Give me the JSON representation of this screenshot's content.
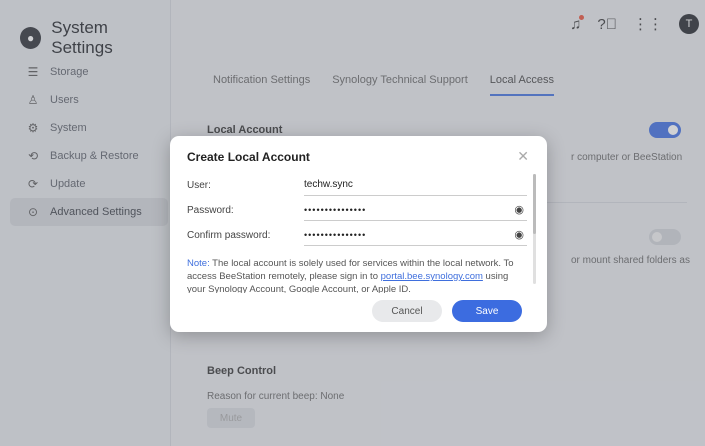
{
  "app": {
    "title": "System Settings"
  },
  "sidebar": {
    "items": [
      {
        "label": "Storage",
        "icon": "storage-icon",
        "glyph": "☰"
      },
      {
        "label": "Users",
        "icon": "user-icon",
        "glyph": "♙"
      },
      {
        "label": "System",
        "icon": "wrench-icon",
        "glyph": "⚙"
      },
      {
        "label": "Backup & Restore",
        "icon": "backup-icon",
        "glyph": "⟲"
      },
      {
        "label": "Update",
        "icon": "update-icon",
        "glyph": "⟳"
      },
      {
        "label": "Advanced Settings",
        "icon": "advanced-icon",
        "glyph": "⊙"
      }
    ],
    "active_index": 5
  },
  "topbar": {
    "avatar_letter": "T"
  },
  "tabs": [
    {
      "label": "Notification Settings"
    },
    {
      "label": "Synology Technical Support"
    },
    {
      "label": "Local Access"
    }
  ],
  "content": {
    "local_account_title": "Local Account",
    "local_account_desc_tail": "r computer or BeeStation",
    "second_desc_tail": "or mount shared folders as",
    "beep_title": "Beep Control",
    "beep_reason": "Reason for current beep: None",
    "mute_label": "Mute"
  },
  "modal": {
    "title": "Create Local Account",
    "fields": {
      "user_label": "User:",
      "user_value": "techw.sync",
      "password_label": "Password:",
      "password_value": "•••••••••••••••",
      "confirm_label": "Confirm password:",
      "confirm_value": "•••••••••••••••"
    },
    "note_label": "Note:",
    "note_text_1": " The local account is solely used for services within the local network. To access BeeStation remotely, please sign in to ",
    "note_link": "portal.bee.synology.com",
    "note_text_2": " using your Synology Account, Google Account, or Apple ID.",
    "cancel_label": "Cancel",
    "save_label": "Save"
  },
  "colors": {
    "accent": "#3c6ce0"
  }
}
